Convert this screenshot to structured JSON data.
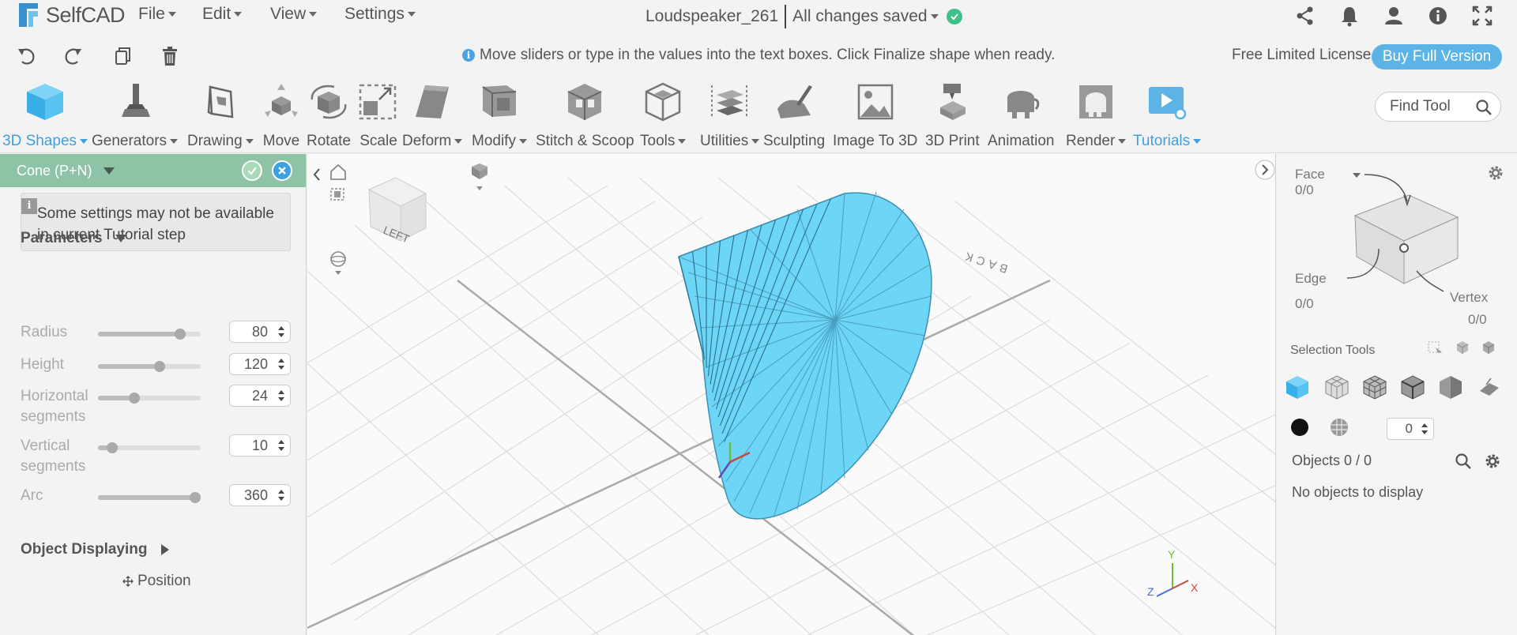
{
  "app": {
    "logo_text": "SelfCAD"
  },
  "menus": [
    {
      "label": "File"
    },
    {
      "label": "Edit"
    },
    {
      "label": "View"
    },
    {
      "label": "Settings"
    }
  ],
  "document": {
    "name": "Loudspeaker_261",
    "save_status": "All changes saved"
  },
  "top_icons": [
    "share-icon",
    "bell-icon",
    "user-icon",
    "info-icon",
    "fullscreen-icon"
  ],
  "actionbar": {
    "hint": "Move sliders or type in the values into the text boxes. Click Finalize shape when ready.",
    "license": "Free Limited License",
    "buy_label": "Buy Full Version"
  },
  "toolbar": {
    "tools": [
      {
        "label": "3D Shapes",
        "dropdown": true,
        "active": true
      },
      {
        "label": "Generators",
        "dropdown": true
      },
      {
        "label": "Drawing",
        "dropdown": true
      },
      {
        "label": "Move"
      },
      {
        "label": "Rotate"
      },
      {
        "label": "Scale"
      },
      {
        "label": "Deform",
        "dropdown": true
      },
      {
        "label": "Modify",
        "dropdown": true
      },
      {
        "label": "Stitch & Scoop"
      },
      {
        "label": "Tools",
        "dropdown": true
      },
      {
        "label": "Utilities",
        "dropdown": true
      },
      {
        "label": "Sculpting"
      },
      {
        "label": "Image To 3D"
      },
      {
        "label": "3D Print"
      },
      {
        "label": "Animation"
      },
      {
        "label": "Render",
        "dropdown": true
      },
      {
        "label": "Tutorials",
        "dropdown": true,
        "accent": true
      }
    ],
    "find_tool_placeholder": "Find Tool"
  },
  "left_panel": {
    "header": "Cone (P+N)",
    "note": "Some settings may not be available in current Tutorial step",
    "parameters_title": "Parameters",
    "params": [
      {
        "label": "Radius",
        "value": "80",
        "slider_fraction": 0.8
      },
      {
        "label": "Height",
        "value": "120",
        "slider_fraction": 0.6
      },
      {
        "label": "Horizontal segments",
        "value": "24",
        "slider_fraction": 0.35
      },
      {
        "label": "Vertical segments",
        "value": "10",
        "slider_fraction": 0.14
      },
      {
        "label": "Arc",
        "value": "360",
        "slider_fraction": 1.0
      }
    ],
    "object_displaying": "Object Displaying",
    "position_label": "Position"
  },
  "viewport": {
    "cube_labels": {
      "left": "LEFT",
      "back": "BACK"
    },
    "axes": {
      "x": "X",
      "y": "Y",
      "z": "Z"
    },
    "colors": {
      "shape": "#6dd5f5",
      "shape_edge": "#3f8fb0",
      "grid": "#d9d9d9"
    }
  },
  "right_panel": {
    "face_label": "Face",
    "face_count": "0/0",
    "edge_label": "Edge",
    "edge_count": "0/0",
    "vertex_label": "Vertex",
    "vertex_count": "0/0",
    "selection_tools": "Selection Tools",
    "stepper_value": "0",
    "objects_label": "Objects 0 / 0",
    "no_objects": "No objects to display"
  },
  "colors": {
    "accent": "#3ea0e0",
    "panel_header": "#8fc3a6",
    "buy_button": "#5cb3e6",
    "saved_ok": "#3fbf8a"
  }
}
